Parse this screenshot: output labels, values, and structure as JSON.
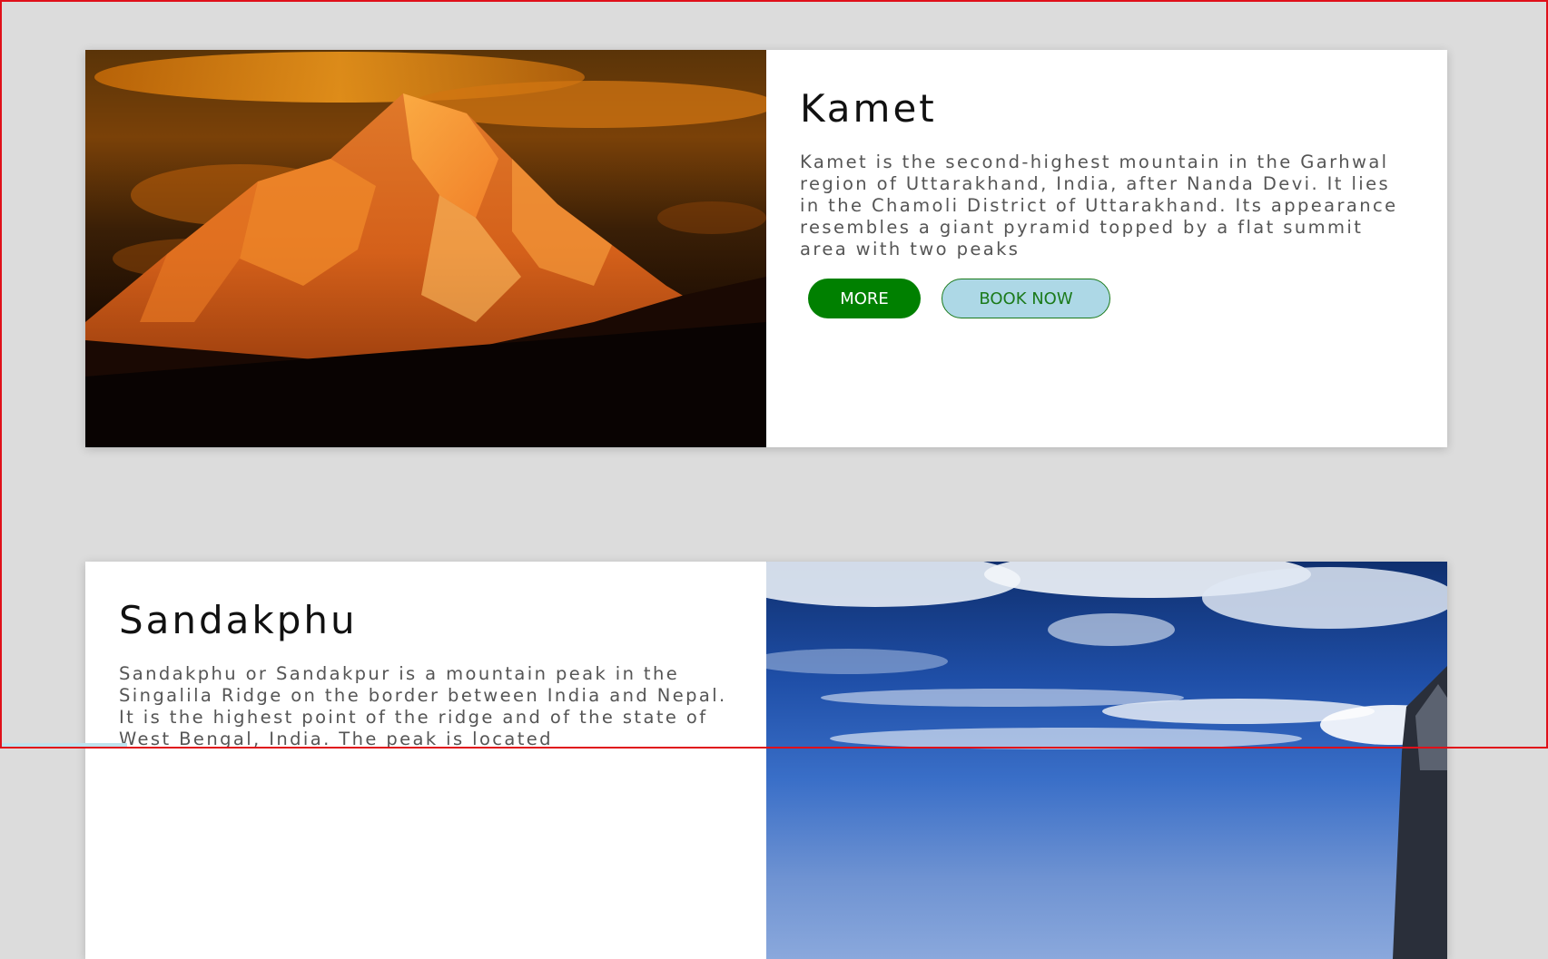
{
  "cards": [
    {
      "title": "Kamet",
      "description": "Kamet is the second-highest mountain in the Garhwal region of Uttarakhand, India, after Nanda Devi. It lies in the Chamoli District of Uttarakhand. Its appearance resembles a giant pyramid topped by a flat summit area with two peaks",
      "more_label": "MORE",
      "book_label": "BOOK NOW"
    },
    {
      "title": "Sandakphu",
      "description": "Sandakphu or Sandakpur is a mountain peak in the Singalila Ridge on the border between India and Nepal. It is the highest point of the ridge and of the state of West Bengal, India. The peak is located"
    }
  ],
  "colors": {
    "page_background": "#dcdcdc",
    "more_button": "#008000",
    "book_button": "#add8e6",
    "book_text": "#1b7a1b",
    "frame_border": "#e0101a"
  }
}
